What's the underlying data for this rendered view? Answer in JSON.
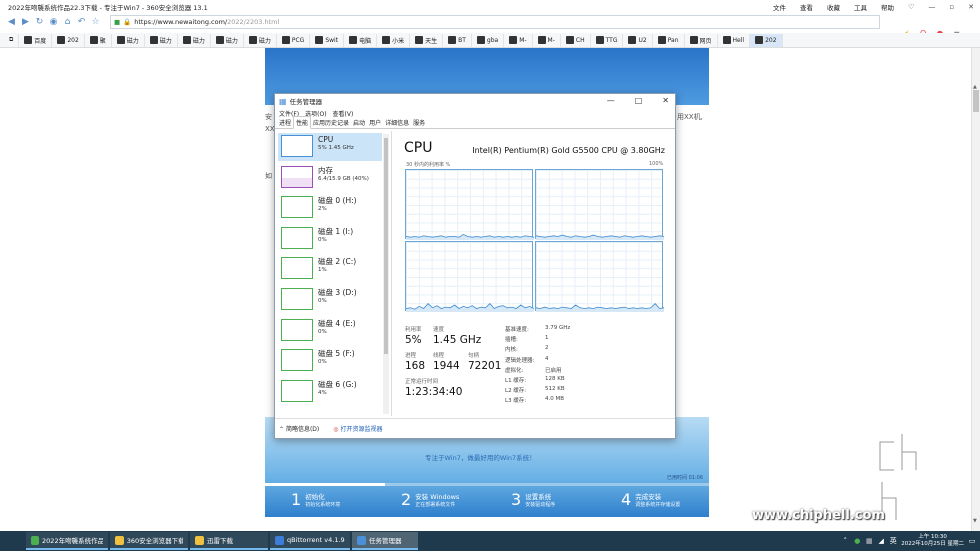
{
  "browser": {
    "title": "2022年吻襲系统作品22.3下载 - 专注于Win7 - 360安全浏览器 13.1",
    "menus": [
      "文件",
      "查看",
      "收藏",
      "工具",
      "帮助"
    ],
    "url_host": "https://www.newaitong.com/",
    "url_path": "2022/2203.html",
    "favorites": [
      "百度",
      "202",
      "聚",
      "磁力",
      "磁力",
      "磁力",
      "磁力",
      "磁力",
      "PCG",
      "Swit",
      "电脑",
      "小米",
      "天生",
      "BT",
      "gba",
      "M-",
      "M-",
      "CH",
      "TTG",
      "U2",
      "Pan",
      "网页",
      "Hell",
      "202"
    ]
  },
  "page": {
    "text_left": "安",
    "text_right": "用XX机,",
    "text_xx": "XX",
    "text_ru": "如",
    "slogan": "专注于Win7，做最好用的Win7系统！",
    "progress_label": "已用时间 01:06",
    "steps": [
      {
        "num": "1",
        "title": "初始化",
        "sub": "初始化系统环境"
      },
      {
        "num": "2",
        "title": "安装 Windows",
        "sub": "正在部署系统文件"
      },
      {
        "num": "3",
        "title": "设置系统",
        "sub": "安装驱动程序"
      },
      {
        "num": "4",
        "title": "完成安装",
        "sub": "调整系统并存储设置"
      }
    ],
    "watermark": "www.chiphell.com"
  },
  "tm": {
    "title": "任务管理器",
    "menu": [
      "文件(F)",
      "选项(O)",
      "查看(V)"
    ],
    "tabs": [
      "进程",
      "性能",
      "应用历史记录",
      "启动",
      "用户",
      "详细信息",
      "服务"
    ],
    "side": [
      {
        "name": "CPU",
        "value": "5% 1.45 GHz",
        "color": "#4a90d9"
      },
      {
        "name": "内存",
        "value": "6.4/15.9 GB (40%)",
        "color": "#9b4fb5"
      },
      {
        "name": "磁盘 0 (H:)",
        "value": "2%",
        "color": "#4caf50"
      },
      {
        "name": "磁盘 1 (I:)",
        "value": "0%",
        "color": "#4caf50"
      },
      {
        "name": "磁盘 2 (C:)",
        "value": "1%",
        "color": "#4caf50"
      },
      {
        "name": "磁盘 3 (D:)",
        "value": "0%",
        "color": "#4caf50"
      },
      {
        "name": "磁盘 4 (E:)",
        "value": "0%",
        "color": "#4caf50"
      },
      {
        "name": "磁盘 5 (F:)",
        "value": "0%",
        "color": "#4caf50"
      },
      {
        "name": "磁盘 6 (G:)",
        "value": "4%",
        "color": "#4caf50"
      }
    ],
    "footer_less": "简略信息(D)",
    "footer_link": "打开资源监视器",
    "cpu_label": "CPU",
    "cpu_model": "Intel(R) Pentium(R) Gold G5500 CPU @ 3.80GHz",
    "util_label": "30 秒内的利用率 %",
    "util_max": "100%",
    "util_series": [
      [
        5,
        4,
        5,
        4,
        6,
        5,
        4,
        5,
        6,
        4,
        5,
        5,
        4,
        8,
        5,
        4,
        5,
        4,
        5,
        6,
        4,
        5,
        4,
        5,
        4,
        5,
        4,
        6,
        5,
        4
      ],
      [
        6,
        5,
        4,
        5,
        6,
        5,
        7,
        5,
        4,
        6,
        5,
        4,
        5,
        7,
        5,
        4,
        5,
        6,
        5,
        4,
        6,
        5,
        4,
        5,
        6,
        5,
        4,
        5,
        6,
        5
      ],
      [
        5,
        6,
        4,
        8,
        5,
        12,
        6,
        9,
        5,
        7,
        6,
        10,
        5,
        8,
        6,
        9,
        5,
        7,
        6,
        12,
        5,
        8,
        9,
        6,
        7,
        5,
        10,
        6,
        8,
        5
      ],
      [
        6,
        5,
        7,
        5,
        6,
        5,
        7,
        6,
        5,
        10,
        6,
        5,
        6,
        5,
        7,
        6,
        5,
        6,
        5,
        6,
        7,
        5,
        6,
        5,
        6,
        5,
        6,
        12,
        5,
        6
      ]
    ],
    "stats": {
      "util_label": "利用率",
      "util_value": "5%",
      "speed_label": "速度",
      "speed_value": "1.45 GHz",
      "proc_label": "进程",
      "proc_value": "168",
      "thread_label": "线程",
      "thread_value": "1944",
      "handle_label": "句柄",
      "handle_value": "72201",
      "uptime_label": "正常运行时间",
      "uptime_value": "1:23:34:40"
    },
    "details": [
      {
        "k": "基准速度:",
        "v": "3.79 GHz"
      },
      {
        "k": "插槽:",
        "v": "1"
      },
      {
        "k": "内核:",
        "v": "2"
      },
      {
        "k": "逻辑处理器:",
        "v": "4"
      },
      {
        "k": "虚拟化:",
        "v": "已启用"
      },
      {
        "k": "L1 缓存:",
        "v": "128 KB"
      },
      {
        "k": "L2 缓存:",
        "v": "512 KB"
      },
      {
        "k": "L3 缓存:",
        "v": "4.0 MB"
      }
    ]
  },
  "taskbar": {
    "items": [
      {
        "label": "2022年吻襲系统作品...",
        "color": "#4caf50"
      },
      {
        "label": "360安全浏览器下载",
        "color": "#f0c040"
      },
      {
        "label": "迅雷下载",
        "color": "#f0c040"
      },
      {
        "label": "qBittorrent v4.1.9",
        "color": "#3b7dd8"
      },
      {
        "label": "任务管理器",
        "color": "#4a90d9"
      }
    ],
    "ime": "英",
    "time": "上午 10:30",
    "date": "2022年10月25日 星期二"
  }
}
